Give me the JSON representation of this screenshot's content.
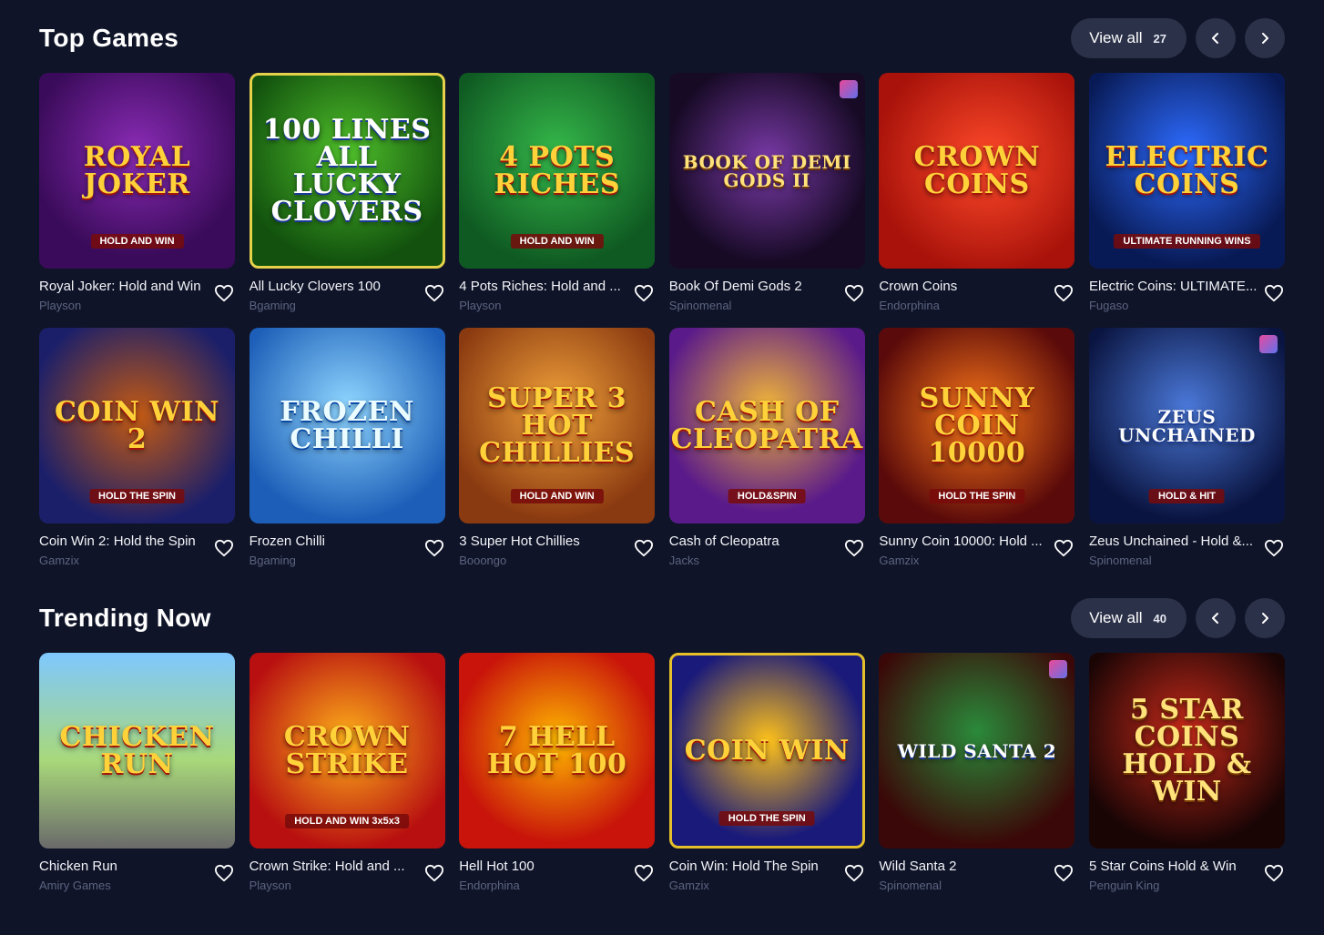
{
  "top_games": {
    "title": "Top Games",
    "view_all_label": "View all",
    "view_all_count": "27",
    "games": [
      {
        "title": "Royal Joker: Hold and Win",
        "provider": "Playson",
        "art": "ROYAL JOKER",
        "art_sub": "HOLD AND WIN"
      },
      {
        "title": "All Lucky Clovers 100",
        "provider": "Bgaming",
        "art": "100 LINES ALL LUCKY CLOVERS",
        "art_sub": ""
      },
      {
        "title": "4 Pots Riches: Hold and ...",
        "provider": "Playson",
        "art": "4 POTS RICHES",
        "art_sub": "HOLD AND WIN"
      },
      {
        "title": "Book Of Demi Gods 2",
        "provider": "Spinomenal",
        "art": "BOOK OF DEMI GODS II",
        "art_sub": ""
      },
      {
        "title": "Crown Coins",
        "provider": "Endorphina",
        "art": "CROWN COINS",
        "art_sub": ""
      },
      {
        "title": "Electric Coins: ULTIMATE...",
        "provider": "Fugaso",
        "art": "ELECTRIC COINS",
        "art_sub": "ULTIMATE RUNNING WINS"
      },
      {
        "title": "Coin Win 2: Hold the Spin",
        "provider": "Gamzix",
        "art": "COIN WIN 2",
        "art_sub": "HOLD THE SPIN"
      },
      {
        "title": "Frozen Chilli",
        "provider": "Bgaming",
        "art": "FROZEN CHILLI",
        "art_sub": ""
      },
      {
        "title": "3 Super Hot Chillies",
        "provider": "Booongo",
        "art": "SUPER 3 HOT CHILLIES",
        "art_sub": "HOLD AND WIN"
      },
      {
        "title": "Cash of Cleopatra",
        "provider": "Jacks",
        "art": "CASH OF CLEOPATRA",
        "art_sub": "HOLD&SPIN"
      },
      {
        "title": "Sunny Coin 10000: Hold ...",
        "provider": "Gamzix",
        "art": "SUNNY COIN 10000",
        "art_sub": "HOLD THE SPIN"
      },
      {
        "title": "Zeus Unchained - Hold &...",
        "provider": "Spinomenal",
        "art": "ZEUS UNCHAINED",
        "art_sub": "HOLD & HIT"
      }
    ]
  },
  "trending_now": {
    "title": "Trending Now",
    "view_all_label": "View all",
    "view_all_count": "40",
    "games": [
      {
        "title": "Chicken Run",
        "provider": "Amiry Games",
        "art": "CHICKEN RUN",
        "art_sub": ""
      },
      {
        "title": "Crown Strike: Hold and ...",
        "provider": "Playson",
        "art": "CROWN STRIKE",
        "art_sub": "HOLD AND WIN 3x5x3"
      },
      {
        "title": "Hell Hot 100",
        "provider": "Endorphina",
        "art": "7 HELL HOT 100",
        "art_sub": ""
      },
      {
        "title": "Coin Win: Hold The Spin",
        "provider": "Gamzix",
        "art": "COIN WIN",
        "art_sub": "HOLD THE SPIN"
      },
      {
        "title": "Wild Santa 2",
        "provider": "Spinomenal",
        "art": "WILD SANTA 2",
        "art_sub": ""
      },
      {
        "title": "5 Star Coins Hold & Win",
        "provider": "Penguin King",
        "art": "5 STAR COINS HOLD & WIN",
        "art_sub": ""
      }
    ]
  }
}
